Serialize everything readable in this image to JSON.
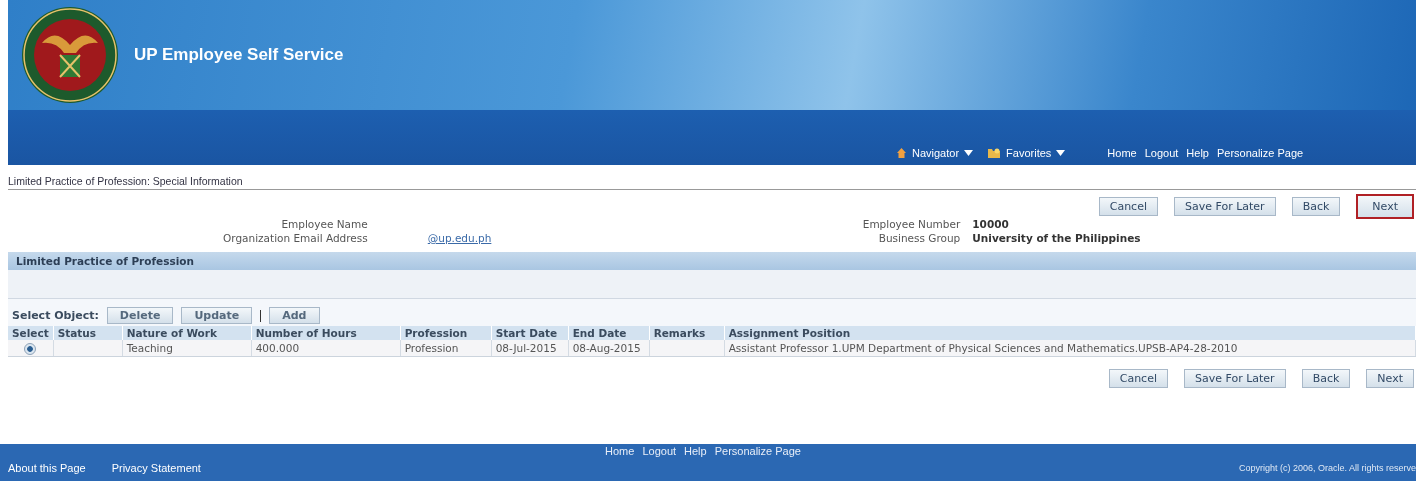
{
  "header": {
    "title": "UP Employee Self Service"
  },
  "global_nav": {
    "menus": [
      {
        "label": "Navigator"
      },
      {
        "label": "Favorites"
      }
    ],
    "links": [
      "Home",
      "Logout",
      "Help",
      "Personalize Page"
    ]
  },
  "page_title": "Limited Practice of Profession: Special Information",
  "actions_top": [
    {
      "label": "Cancel",
      "highlighted": false
    },
    {
      "label": "Save For Later",
      "highlighted": false
    },
    {
      "label": "Back",
      "highlighted": false
    },
    {
      "label": "Next",
      "highlighted": true
    }
  ],
  "employee_left": [
    {
      "label": "Employee Name",
      "kind": "text"
    },
    {
      "label": "Organization Email Address",
      "value": "@up.edu.ph",
      "kind": "link"
    }
  ],
  "employee_right": [
    {
      "label": "Employee Number",
      "value": "10000"
    },
    {
      "label": "Business Group",
      "value": "University of the Philippines"
    }
  ],
  "section": {
    "title": "Limited Practice of Profession",
    "select_label": "Select Object:",
    "table_actions": [
      "Delete",
      "Update",
      "Add"
    ],
    "columns": [
      "Select",
      "Status",
      "Nature of Work",
      "Number of Hours",
      "Profession",
      "Start Date",
      "End Date",
      "Remarks",
      "Assignment Position"
    ],
    "rows": [
      {
        "selected": true,
        "cells": [
          "",
          "",
          "Teaching",
          "400.000",
          "Profession",
          "08-Jul-2015",
          "08-Aug-2015",
          "",
          "Assistant Professor 1.UPM Department of Physical Sciences and Mathematics.UPSB-AP4-28-2010"
        ]
      }
    ]
  },
  "actions_bottom": [
    {
      "label": "Cancel",
      "highlighted": false
    },
    {
      "label": "Save For Later",
      "highlighted": false
    },
    {
      "label": "Back",
      "highlighted": false
    },
    {
      "label": "Next",
      "highlighted": false
    }
  ],
  "footer": {
    "links": [
      "Home",
      "Logout",
      "Help",
      "Personalize Page"
    ],
    "left_links": [
      "About this Page",
      "Privacy Statement"
    ],
    "copyright": "Copyright (c) 2006, Oracle. All rights reserve"
  }
}
